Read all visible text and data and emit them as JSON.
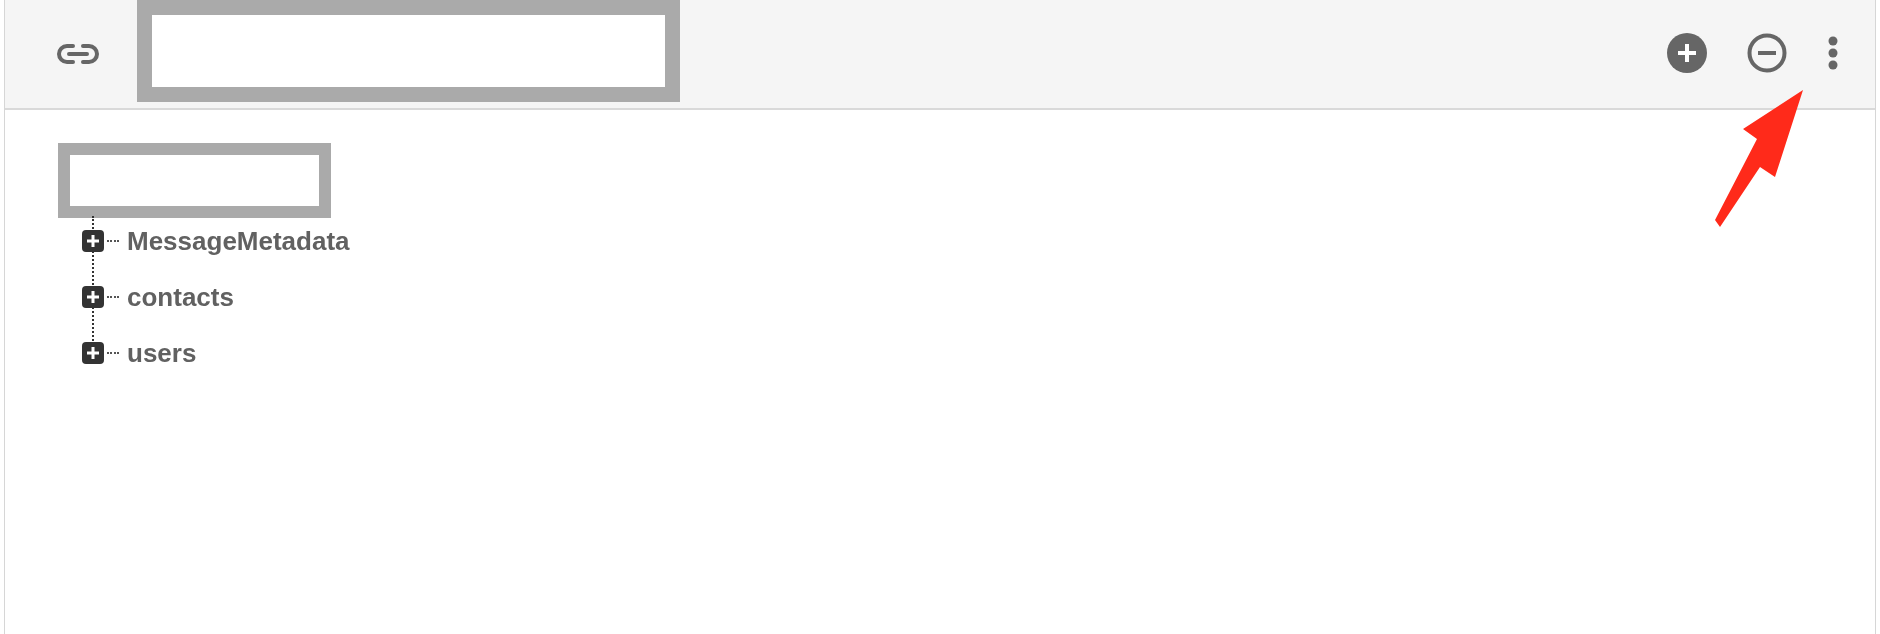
{
  "tree": {
    "items": [
      {
        "label": "MessageMetadata",
        "expanded": false
      },
      {
        "label": "contacts",
        "expanded": false
      },
      {
        "label": "users",
        "expanded": false
      }
    ]
  }
}
